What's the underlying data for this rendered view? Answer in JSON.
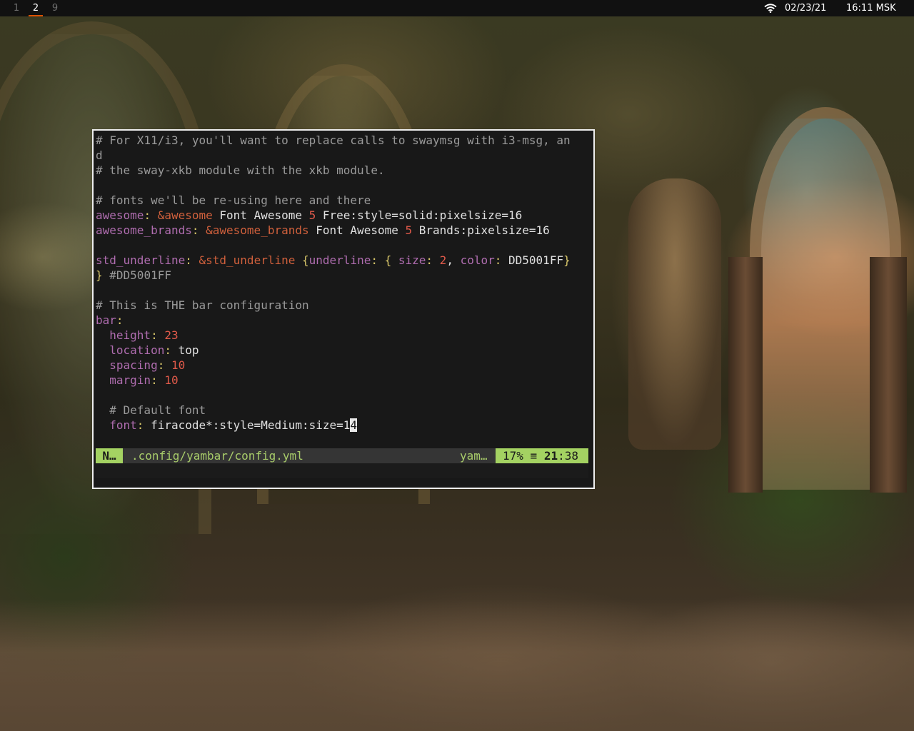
{
  "topbar": {
    "workspaces": [
      {
        "label": "1",
        "active": false
      },
      {
        "label": "2",
        "active": true
      },
      {
        "label": "9",
        "active": false
      }
    ],
    "wifi_icon": "wifi-icon",
    "date": "02/23/21",
    "time": "16:11 MSK",
    "accent_color": "#DD5001"
  },
  "editor": {
    "lines": [
      {
        "parts": [
          [
            "cm",
            "# For X11/i3, you'll want to replace calls to swaymsg with i3-msg, an"
          ]
        ]
      },
      {
        "parts": [
          [
            "cm",
            "d"
          ]
        ]
      },
      {
        "parts": [
          [
            "cm",
            "# the sway-xkb module with the xkb module."
          ]
        ]
      },
      {
        "parts": []
      },
      {
        "parts": [
          [
            "cm",
            "# fonts we'll be re-using here and there"
          ]
        ]
      },
      {
        "parts": [
          [
            "k",
            "awesome"
          ],
          [
            "br",
            ": "
          ],
          [
            "an",
            "&awesome"
          ],
          [
            "str",
            " Font Awesome "
          ],
          [
            "num",
            "5"
          ],
          [
            "str",
            " Free:style=solid:pixelsize=16"
          ]
        ]
      },
      {
        "parts": [
          [
            "k",
            "awesome_brands"
          ],
          [
            "br",
            ": "
          ],
          [
            "an",
            "&awesome_brands"
          ],
          [
            "str",
            " Font Awesome "
          ],
          [
            "num",
            "5"
          ],
          [
            "str",
            " Brands:pixelsize=16"
          ]
        ]
      },
      {
        "parts": []
      },
      {
        "parts": [
          [
            "k",
            "std_underline"
          ],
          [
            "br",
            ": "
          ],
          [
            "an",
            "&std_underline"
          ],
          [
            "str",
            " "
          ],
          [
            "br",
            "{"
          ],
          [
            "k",
            "underline"
          ],
          [
            "br",
            ": { "
          ],
          [
            "k",
            "size"
          ],
          [
            "br",
            ": "
          ],
          [
            "num",
            "2"
          ],
          [
            "str",
            ", "
          ],
          [
            "k",
            "color"
          ],
          [
            "br",
            ": "
          ],
          [
            "str",
            "DD5001FF"
          ],
          [
            "br",
            "}"
          ]
        ]
      },
      {
        "parts": [
          [
            "br",
            "}"
          ],
          [
            "cm",
            " #DD5001FF"
          ]
        ]
      },
      {
        "parts": []
      },
      {
        "parts": [
          [
            "cm",
            "# This is THE bar configuration"
          ]
        ]
      },
      {
        "parts": [
          [
            "k",
            "bar"
          ],
          [
            "br",
            ":"
          ]
        ]
      },
      {
        "parts": [
          [
            "str",
            "  "
          ],
          [
            "k",
            "height"
          ],
          [
            "br",
            ": "
          ],
          [
            "num",
            "23"
          ]
        ]
      },
      {
        "parts": [
          [
            "str",
            "  "
          ],
          [
            "k",
            "location"
          ],
          [
            "br",
            ": "
          ],
          [
            "str",
            "top"
          ]
        ]
      },
      {
        "parts": [
          [
            "str",
            "  "
          ],
          [
            "k",
            "spacing"
          ],
          [
            "br",
            ": "
          ],
          [
            "num",
            "10"
          ]
        ]
      },
      {
        "parts": [
          [
            "str",
            "  "
          ],
          [
            "k",
            "margin"
          ],
          [
            "br",
            ": "
          ],
          [
            "num",
            "10"
          ]
        ]
      },
      {
        "parts": []
      },
      {
        "parts": [
          [
            "cm",
            "  # Default font"
          ]
        ]
      },
      {
        "parts": [
          [
            "str",
            "  "
          ],
          [
            "k",
            "font"
          ],
          [
            "br",
            ": "
          ],
          [
            "str",
            "firacode*:style=Medium:size=1"
          ],
          [
            "cursor",
            "4"
          ]
        ]
      }
    ]
  },
  "statusline": {
    "mode": "N…",
    "path": ".config/yambar/config.yml",
    "filetype": "yam…",
    "percent": "17%",
    "lines_icon": "≡",
    "line": "21",
    "col": ":38"
  },
  "colors": {
    "statusline_green": "#A4D262",
    "comment": "#9A9A9A",
    "key": "#B06DB0",
    "anchor": "#D0603C",
    "number": "#E05A4A"
  }
}
